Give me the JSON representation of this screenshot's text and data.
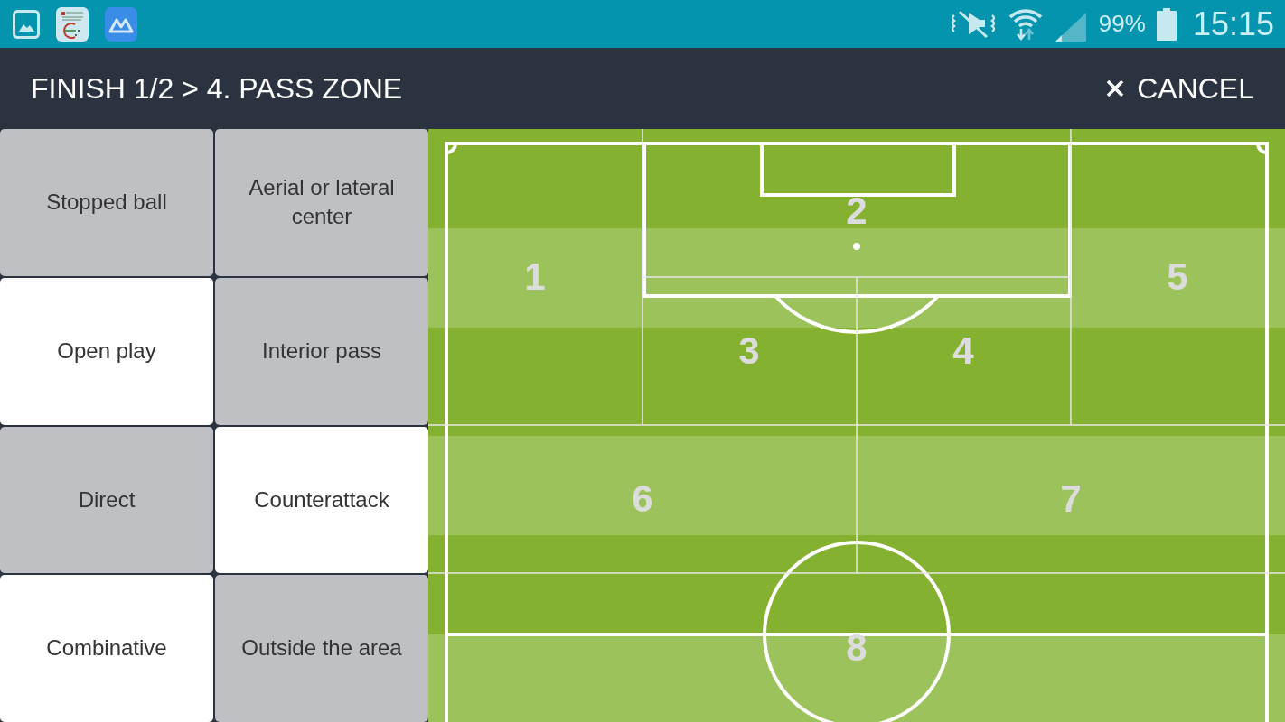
{
  "status_bar": {
    "battery": "99%",
    "time": "15:15"
  },
  "header": {
    "title": "FINISH 1/2 > 4. PASS ZONE",
    "cancel": "CANCEL"
  },
  "option_rows": [
    [
      {
        "label": "Stopped ball",
        "selected": false
      },
      {
        "label": "Aerial or lateral center",
        "selected": false
      }
    ],
    [
      {
        "label": "Open play",
        "selected": true
      },
      {
        "label": "Interior pass",
        "selected": false
      }
    ],
    [
      {
        "label": "Direct",
        "selected": false
      },
      {
        "label": "Counterattack",
        "selected": true
      }
    ],
    [
      {
        "label": "Combinative",
        "selected": true
      },
      {
        "label": "Outside the area",
        "selected": false
      }
    ]
  ],
  "pitch": {
    "zones": [
      {
        "label": "1"
      },
      {
        "label": "2"
      },
      {
        "label": "3"
      },
      {
        "label": "4"
      },
      {
        "label": "5"
      },
      {
        "label": "6"
      },
      {
        "label": "7"
      },
      {
        "label": "8"
      }
    ]
  }
}
